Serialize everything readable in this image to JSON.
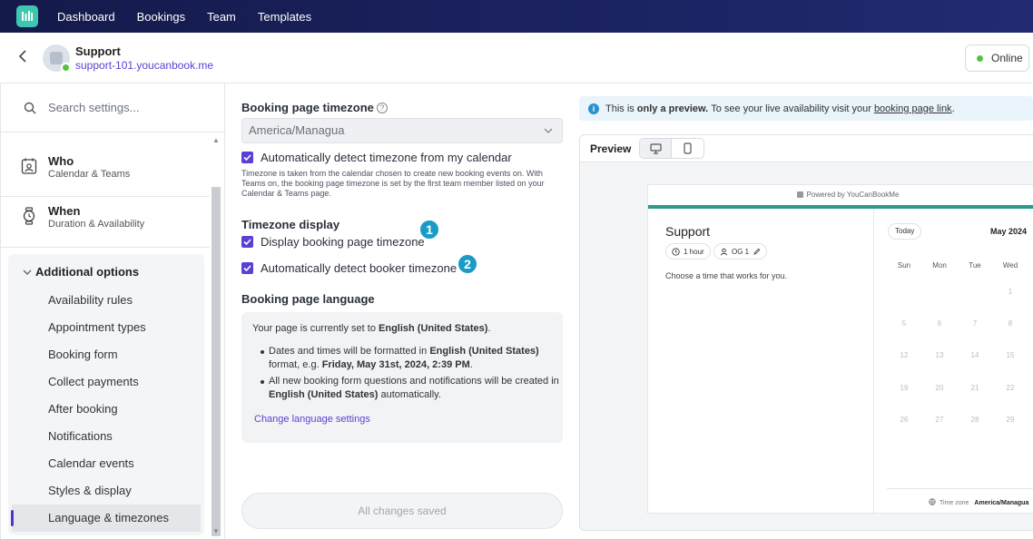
{
  "nav": {
    "items": [
      "Dashboard",
      "Bookings",
      "Team",
      "Templates"
    ]
  },
  "header": {
    "title": "Support",
    "link": "support-101.youcanbook.me",
    "status_button": "Online"
  },
  "sidebar": {
    "search_placeholder": "Search settings...",
    "sections": [
      {
        "title": "Who",
        "subtitle": "Calendar & Teams",
        "icon": "calendar-person-icon"
      },
      {
        "title": "When",
        "subtitle": "Duration & Availability",
        "icon": "watch-icon"
      }
    ],
    "group_title": "Additional options",
    "sub_items": [
      "Availability rules",
      "Appointment types",
      "Booking form",
      "Collect payments",
      "After booking",
      "Notifications",
      "Calendar events",
      "Styles & display",
      "Language & timezones"
    ],
    "active_item": "Language & timezones"
  },
  "settings": {
    "timezone_label": "Booking page timezone",
    "timezone_value": "America/Managua",
    "auto_detect_label": "Automatically detect timezone from my calendar",
    "timezone_note": "Timezone is taken from the calendar chosen to create new booking events on. With Teams on, the booking page timezone is set by the first team member listed on your Calendar & Teams page.",
    "display_heading": "Timezone display",
    "display_tz_label": "Display booking page timezone",
    "detect_booker_label": "Automatically detect booker timezone",
    "badge1": "1",
    "badge2": "2",
    "language_heading": "Booking page language",
    "lang_line_prefix": "Your page is currently set to ",
    "lang_value": "English (United States)",
    "lang_line_suffix": ".",
    "bullet1_a": "Dates and times will be formatted in ",
    "bullet1_b": "English (United States)",
    "bullet1_c": " format, e.g. ",
    "bullet1_d": "Friday, May 31st, 2024, 2:39 PM",
    "bullet1_e": ".",
    "bullet2_a": "All new booking form questions and notifications will be created in ",
    "bullet2_b": "English (United States)",
    "bullet2_c": " automatically.",
    "change_link": "Change language settings",
    "saved_button": "All changes saved"
  },
  "preview": {
    "notice_a": "This is",
    "notice_b": "only a preview.",
    "notice_c": "To see your live availability visit your",
    "notice_link": "booking page link",
    "notice_end": ".",
    "label": "Preview",
    "powered_by": "Powered by YouCanBookMe",
    "title": "Support",
    "duration": "1 hour",
    "owner": "OG 1",
    "choose_text": "Choose a time that works for you.",
    "today_button": "Today",
    "month": "May 2024",
    "weekdays": [
      "Sun",
      "Mon",
      "Tue",
      "Wed"
    ],
    "days": [
      [
        "",
        "",
        "",
        "1"
      ],
      [
        "5",
        "6",
        "7",
        "8"
      ],
      [
        "12",
        "13",
        "14",
        "15"
      ],
      [
        "19",
        "20",
        "21",
        "22"
      ],
      [
        "26",
        "27",
        "28",
        "29"
      ]
    ],
    "timezone_label": "Time zone",
    "timezone_value": "America/Managua"
  }
}
